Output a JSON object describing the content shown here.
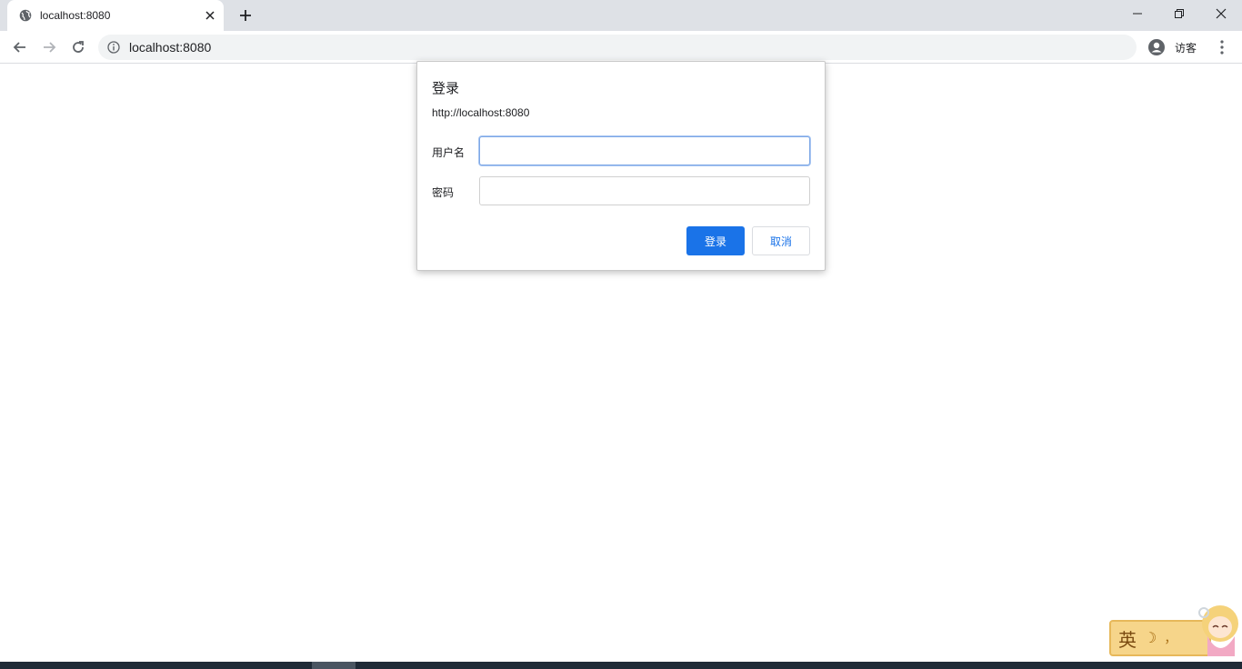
{
  "browser": {
    "tab": {
      "title": "localhost:8080"
    },
    "address": {
      "url": "localhost:8080"
    },
    "profile": {
      "label": "访客"
    }
  },
  "dialog": {
    "title": "登录",
    "origin": "http://localhost:8080",
    "username_label": "用户名",
    "username_value": "",
    "password_label": "密码",
    "password_value": "",
    "login_button": "登录",
    "cancel_button": "取消"
  },
  "ime": {
    "mode_char": "英",
    "moon_icon": "☽",
    "punct_char": "，"
  },
  "colors": {
    "accent": "#1a73e8",
    "chrome_bg": "#dee1e6",
    "omnibox_bg": "#f1f3f4"
  }
}
